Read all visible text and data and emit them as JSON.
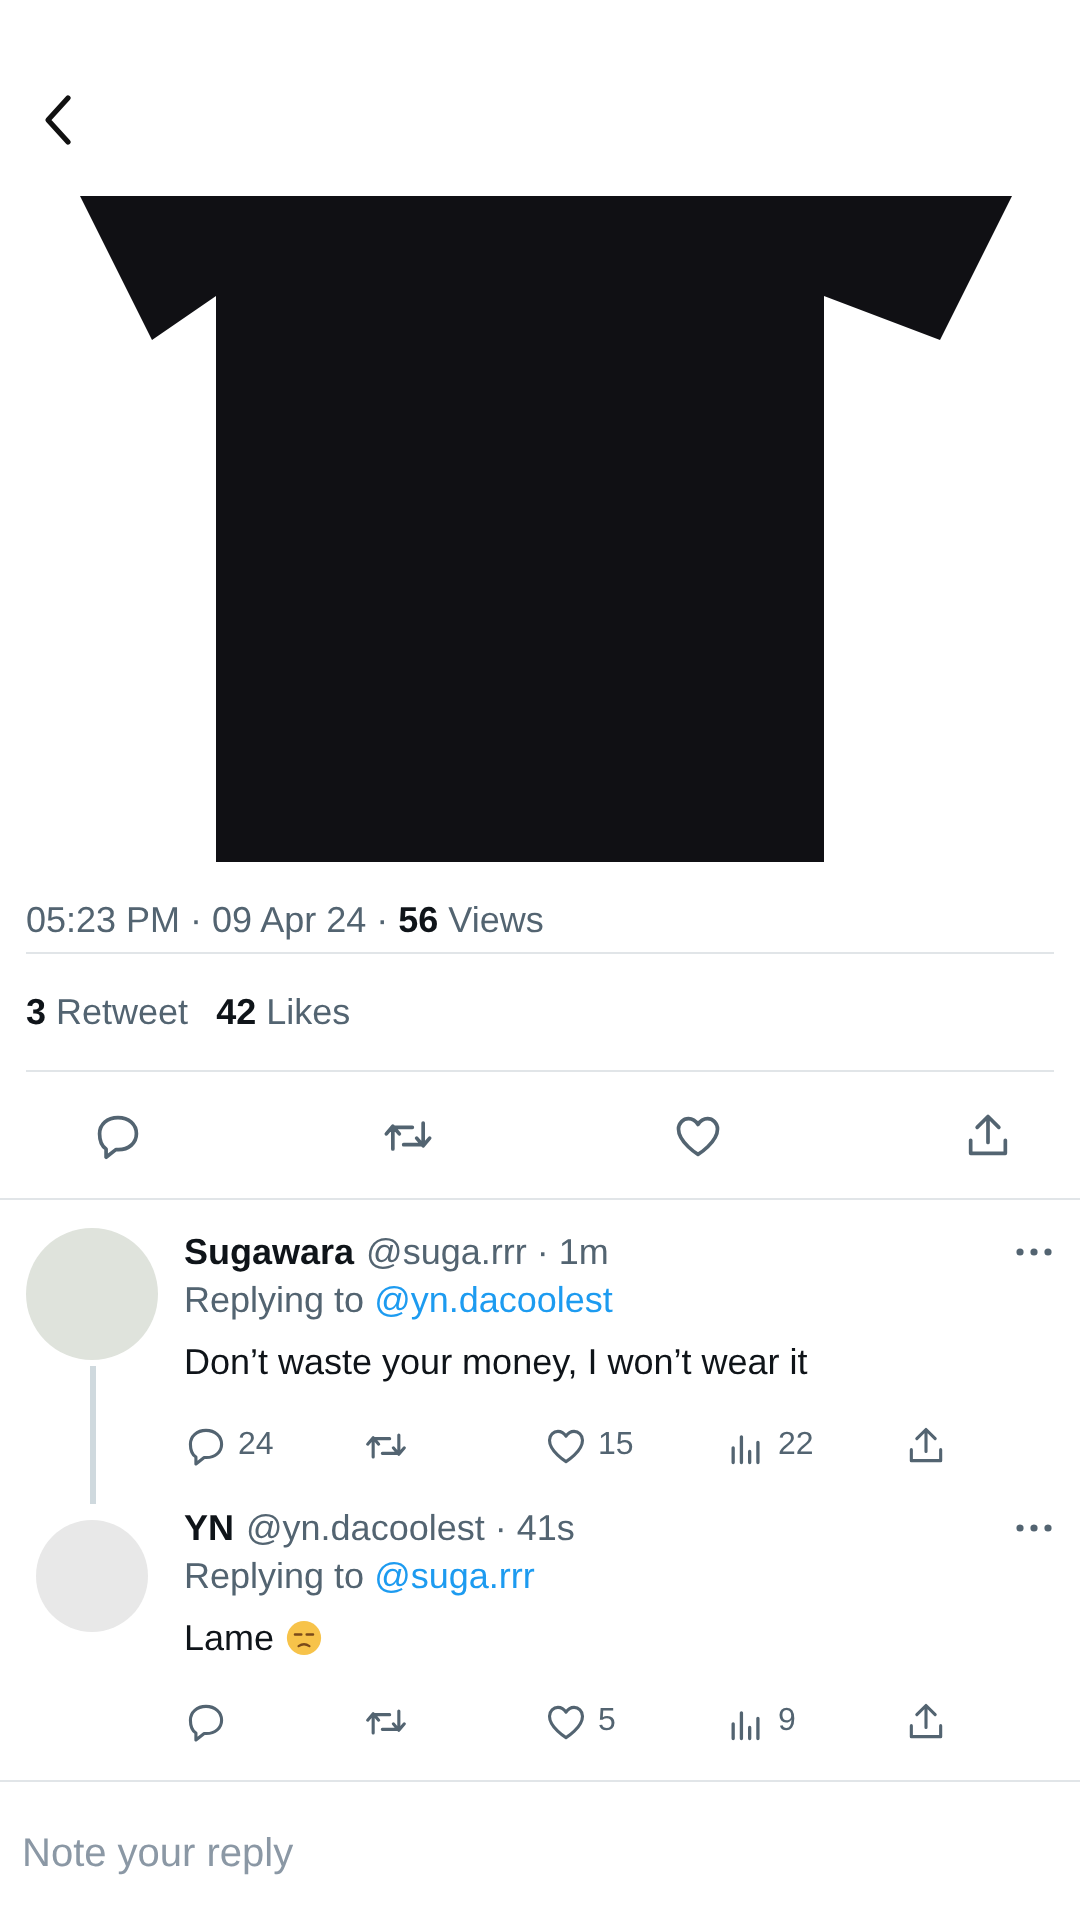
{
  "meta": "05:23 PM · 09 Apr 24 · **56** Views",
  "stats": [
    "**3** Retweet",
    "**42** Likes"
  ],
  "actions": [
    {
      "kind": "reply"
    },
    {
      "kind": "retweet"
    },
    {
      "kind": "like"
    },
    {
      "kind": "share"
    }
  ],
  "replies": [
    {
      "name": "Sugawara",
      "meta": "@suga.rrr · 1m",
      "replying_label": "Replying to",
      "replying_to": "@yn.dacoolest",
      "text": "Don’t waste your money, I won’t wear it",
      "actions": [
        {
          "kind": "reply",
          "count": "24"
        },
        {
          "kind": "retweet"
        },
        {
          "kind": "like",
          "count": "15"
        },
        {
          "kind": "views",
          "count": "22"
        },
        {
          "kind": "share"
        }
      ]
    },
    {
      "name": "YN",
      "meta": "@yn.dacoolest · 41s",
      "replying_label": "Replying to",
      "replying_to": "@suga.rrr",
      "text": "Lame",
      "emoji": true,
      "actions": [
        {
          "kind": "reply"
        },
        {
          "kind": "retweet"
        },
        {
          "kind": "like",
          "count": "5"
        },
        {
          "kind": "views",
          "count": "9"
        },
        {
          "kind": "share"
        }
      ]
    }
  ],
  "reply_field": {
    "placeholder": "Note your reply"
  }
}
